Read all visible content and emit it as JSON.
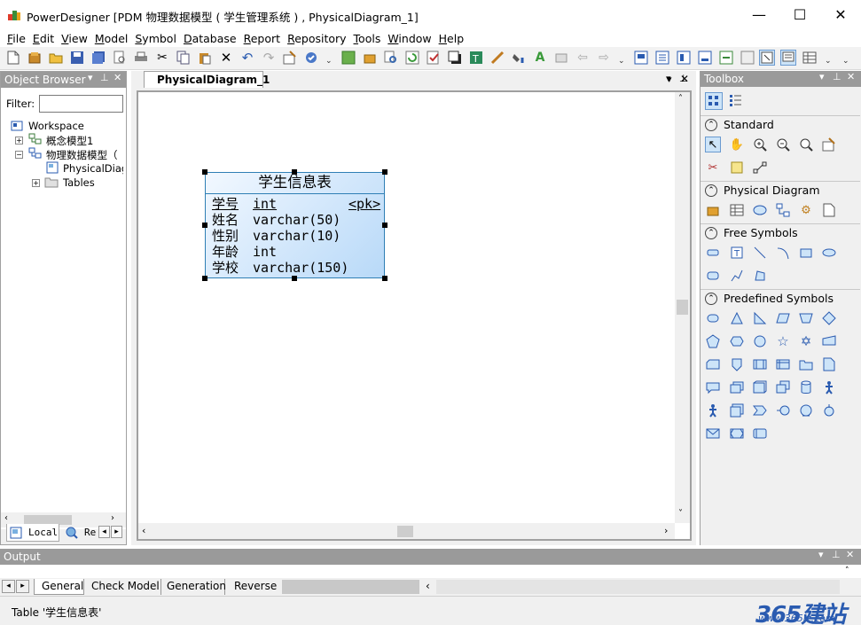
{
  "window": {
    "title": "PowerDesigner [PDM 物理数据模型 ( 学生管理系统 ) , PhysicalDiagram_1]",
    "minimize": "—",
    "maximize": "☐",
    "close": "✕"
  },
  "menu": [
    {
      "key": "F",
      "rest": "ile"
    },
    {
      "key": "E",
      "rest": "dit"
    },
    {
      "key": "V",
      "rest": "iew"
    },
    {
      "key": "M",
      "rest": "odel"
    },
    {
      "key": "S",
      "rest": "ymbol"
    },
    {
      "key": "D",
      "rest": "atabase"
    },
    {
      "key": "R",
      "rest": "eport"
    },
    {
      "key": "R",
      "rest": "epository"
    },
    {
      "key": "T",
      "rest": "ools"
    },
    {
      "key": "W",
      "rest": "indow"
    },
    {
      "key": "H",
      "rest": "elp"
    }
  ],
  "object_browser": {
    "title": "Object Browser",
    "filter_label": "Filter:",
    "filter_value": "",
    "tree": [
      {
        "label": "Workspace"
      },
      {
        "label": "概念模型1"
      },
      {
        "label": "物理数据模型（"
      },
      {
        "label": "PhysicalDiagr"
      },
      {
        "label": "Tables"
      }
    ],
    "tabs": [
      "Local",
      "Re"
    ]
  },
  "diagram": {
    "tab_label": "PhysicalDiagram_1",
    "table": {
      "name": "学生信息表",
      "columns": [
        {
          "name": "学号",
          "type": "int",
          "key": "<pk>"
        },
        {
          "name": "姓名",
          "type": "varchar(50)",
          "key": ""
        },
        {
          "name": "性别",
          "type": "varchar(10)",
          "key": ""
        },
        {
          "name": "年龄",
          "type": "int",
          "key": ""
        },
        {
          "name": "学校",
          "type": "varchar(150)",
          "key": ""
        }
      ]
    }
  },
  "toolbox": {
    "title": "Toolbox",
    "sections": [
      "Standard",
      "Physical Diagram",
      "Free Symbols",
      "Predefined Symbols"
    ]
  },
  "output": {
    "title": "Output",
    "tabs": [
      "General",
      "Check Model",
      "Generation",
      "Reverse"
    ]
  },
  "status": {
    "text": "Table '学生信息表'",
    "watermark": "365建站",
    "watermark_url": "www.365jz.com"
  },
  "colors": {
    "accent": "#2f7fb5",
    "panel_header": "#9a9a9a"
  }
}
